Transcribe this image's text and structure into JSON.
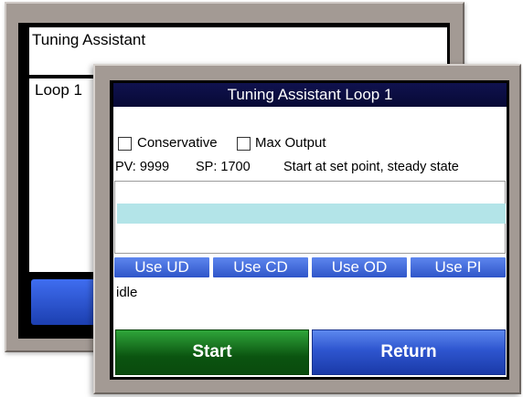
{
  "back_window": {
    "title": "Tuning Assistant",
    "body_text": "Loop 1"
  },
  "front_window": {
    "title": "Tuning Assistant Loop 1",
    "options": {
      "conservative_label": "Conservative",
      "conservative_checked": false,
      "max_output_label": "Max Output",
      "max_output_checked": false
    },
    "readout": {
      "pv": "PV: 9999",
      "sp": "SP: 1700",
      "message": "Start at set point, steady state"
    },
    "buttons": {
      "use_ud": "Use UD",
      "use_cd": "Use CD",
      "use_od": "Use OD",
      "use_pi": "Use PI",
      "start": "Start",
      "return": "Return"
    },
    "status": "idle"
  },
  "colors": {
    "title_bar": "#0a0c40",
    "progress_fill": "#b3e4e8",
    "use_buttons": "#3f66d8",
    "start_button": "#0b5410",
    "return_button": "#2e55cf",
    "bezel": "#a39a94"
  }
}
